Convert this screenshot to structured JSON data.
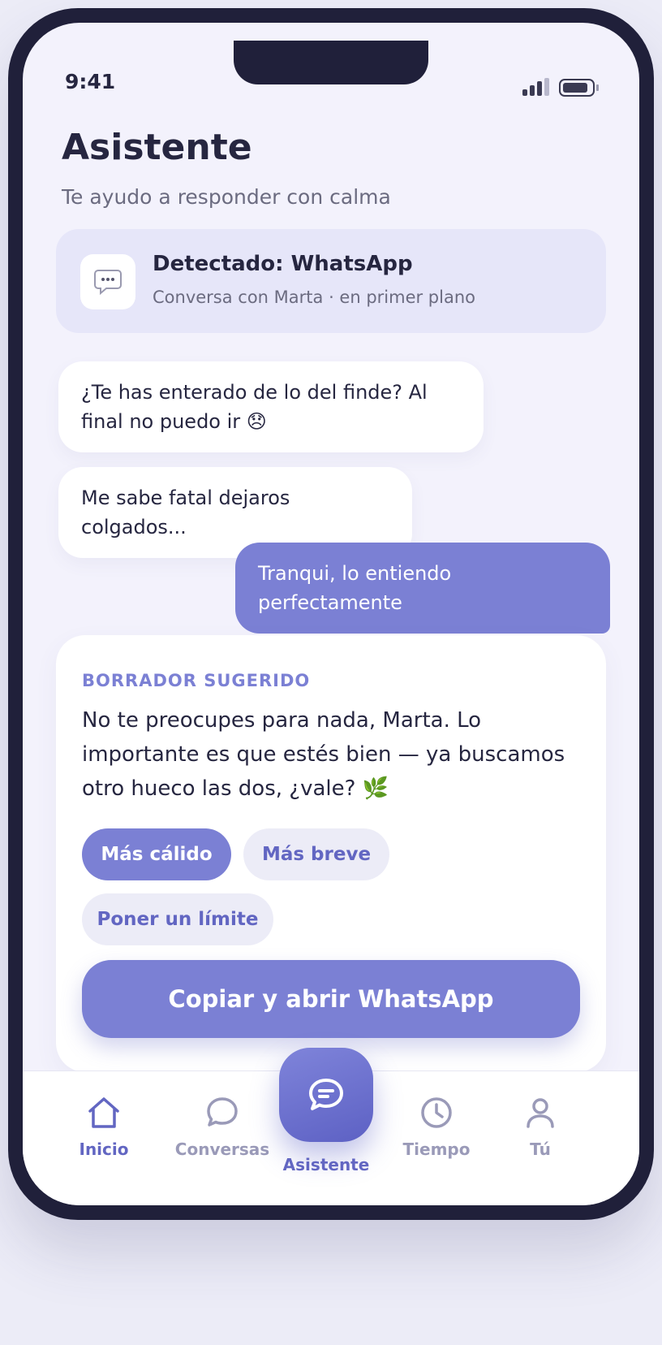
{
  "status": {
    "time": "9:41"
  },
  "header": {
    "title": "Asistente",
    "subtitle": "Te ayudo a responder con calma"
  },
  "detected": {
    "title": "Detectado: WhatsApp",
    "subtitle": "Conversa con Marta · en primer plano",
    "icon": "chat-bubble-icon"
  },
  "conversation": [
    {
      "direction": "incoming",
      "text": "¿Te has enterado de lo del finde? Al final no puedo ir 😞"
    },
    {
      "direction": "incoming",
      "text": "Me sabe fatal dejaros colgados..."
    },
    {
      "direction": "outgoing",
      "text": "Tranqui, lo entiendo perfectamente"
    }
  ],
  "draft": {
    "label": "BORRADOR SUGERIDO",
    "text": "No te preocupes para nada, Marta. Lo importante es que estés bien — ya buscamos otro hueco las dos, ¿vale? 🌿",
    "chips": [
      {
        "label": "Más cálido",
        "active": true
      },
      {
        "label": "Más breve",
        "active": false
      },
      {
        "label": "Poner un límite",
        "active": false
      }
    ],
    "cta": "Copiar y abrir WhatsApp"
  },
  "tabs": [
    {
      "label": "Inicio",
      "icon": "home-icon",
      "active": true
    },
    {
      "label": "Conversas",
      "icon": "chat-icon",
      "active": false
    },
    {
      "label": "Asistente",
      "icon": "assistant-chat-icon",
      "active": true
    },
    {
      "label": "Tiempo",
      "icon": "clock-icon",
      "active": false
    },
    {
      "label": "Tú",
      "icon": "user-icon",
      "active": false
    }
  ],
  "colors": {
    "accent": "#7b80d4",
    "accent_dark": "#6266c2",
    "background": "#f3f2fc",
    "card_tint": "#e6e6f9"
  }
}
